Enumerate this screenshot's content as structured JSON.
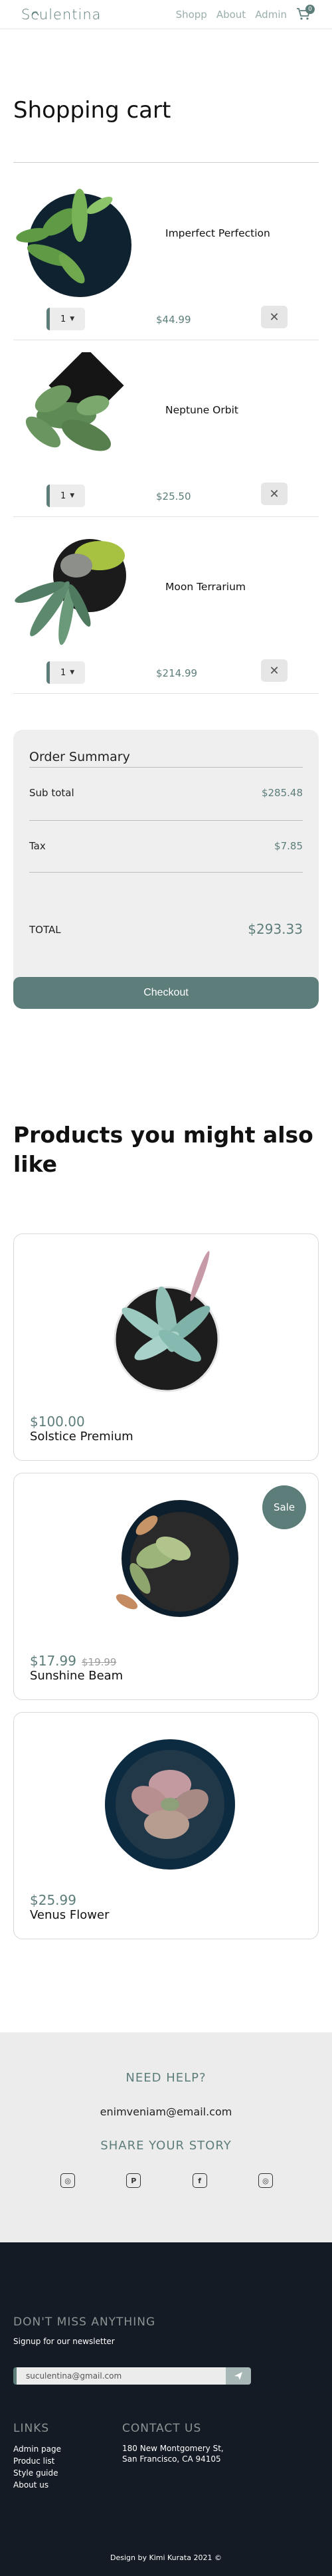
{
  "header": {
    "logo_prefix": "S",
    "logo_rest": "culentina",
    "nav": [
      "Shopp",
      "About",
      "Admin"
    ],
    "cart_count": "0"
  },
  "cart": {
    "title": "Shopping cart",
    "items": [
      {
        "name": "Imperfect Perfection",
        "qty": "1",
        "price": "$44.99"
      },
      {
        "name": "Neptune Orbit",
        "qty": "1",
        "price": "$25.50"
      },
      {
        "name": "Moon Terrarium",
        "qty": "1",
        "price": "$214.99"
      }
    ]
  },
  "summary": {
    "title": "Order Summary",
    "subtotal_label": "Sub total",
    "subtotal": "$285.48",
    "tax_label": "Tax",
    "tax": "$7.85",
    "total_label": "TOTAL",
    "total": "$293.33",
    "checkout": "Checkout"
  },
  "recommendations": {
    "title": "Products you might also like",
    "products": [
      {
        "price": "$100.00",
        "old_price": "",
        "name": "Solstice Premium",
        "badge": ""
      },
      {
        "price": "$17.99",
        "old_price": "$19.99",
        "name": "Sunshine Beam",
        "badge": "Sale"
      },
      {
        "price": "$25.99",
        "old_price": "",
        "name": "Venus Flower",
        "badge": ""
      }
    ]
  },
  "help": {
    "title": "NEED HELP?",
    "email": "enimveniam@email.com",
    "story": "SHARE YOUR STORY",
    "socials": [
      "instagram-icon",
      "pinterest-icon",
      "facebook-icon",
      "instagram-icon"
    ]
  },
  "footer": {
    "newsletter_title": "DON'T MISS ANYTHING",
    "newsletter_sub": "Signup for our newsletter",
    "newsletter_value": "suculentina@gmail.com",
    "links_title": "LINKS",
    "links": [
      "Admin page",
      "Produc list",
      "Style guide",
      "About us"
    ],
    "contact_title": "CONTACT US",
    "address_line1": "180 New Montgomery St,",
    "address_line2": "San Francisco, CA 94105",
    "copyright": "Design by Kimi Kurata 2021 ©"
  },
  "colors": {
    "accent": "#5d7d7b",
    "footer_bg": "#141b24",
    "panel_bg": "#efefef"
  }
}
